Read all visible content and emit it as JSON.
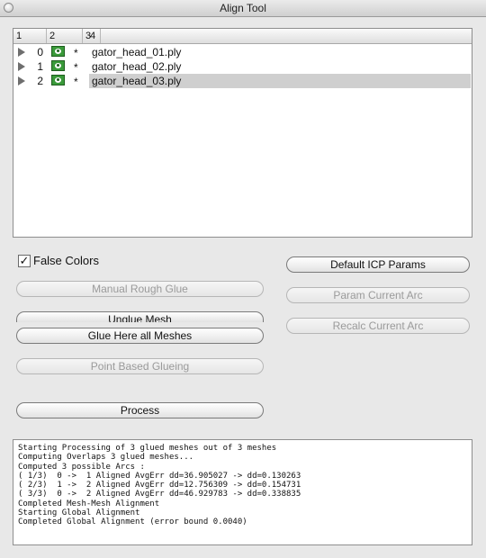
{
  "window": {
    "title": "Align Tool"
  },
  "mesh_list": {
    "columns": [
      "1",
      "2",
      "3",
      "4"
    ],
    "rows": [
      {
        "index": "0",
        "visible_icon": "eye-icon",
        "star": "*",
        "filename": "gator_head_01.ply",
        "selected": false
      },
      {
        "index": "1",
        "visible_icon": "eye-icon",
        "star": "*",
        "filename": "gator_head_02.ply",
        "selected": false
      },
      {
        "index": "2",
        "visible_icon": "eye-icon",
        "star": "*",
        "filename": "gator_head_03.ply",
        "selected": true
      }
    ]
  },
  "controls": {
    "false_colors_label": "False Colors",
    "false_colors_checked": true,
    "check_mark": "✓",
    "manual_rough_glue": "Manual Rough Glue",
    "unglue_mesh": "Unglue Mesh",
    "glue_here_all_meshes": "Glue Here all Meshes",
    "point_based_glueing": "Point Based Glueing",
    "process": "Process",
    "default_icp_params": "Default ICP Params",
    "param_current_arc": "Param Current Arc",
    "recalc_current_arc": "Recalc Current Arc"
  },
  "log": {
    "lines": [
      "Starting Processing of 3 glued meshes out of 3 meshes",
      "Computing Overlaps 3 glued meshes...",
      "Computed 3 possible Arcs :",
      "( 1/3)  0 ->  1 Aligned AvgErr dd=36.905027 -> dd=0.130263",
      "( 2/3)  1 ->  2 Aligned AvgErr dd=12.756309 -> dd=0.154731",
      "( 3/3)  0 ->  2 Aligned AvgErr dd=46.929783 -> dd=0.338835",
      "Completed Mesh-Mesh Alignment",
      "Starting Global Alignment",
      "Completed Global Alignment (error bound 0.0040)"
    ]
  }
}
